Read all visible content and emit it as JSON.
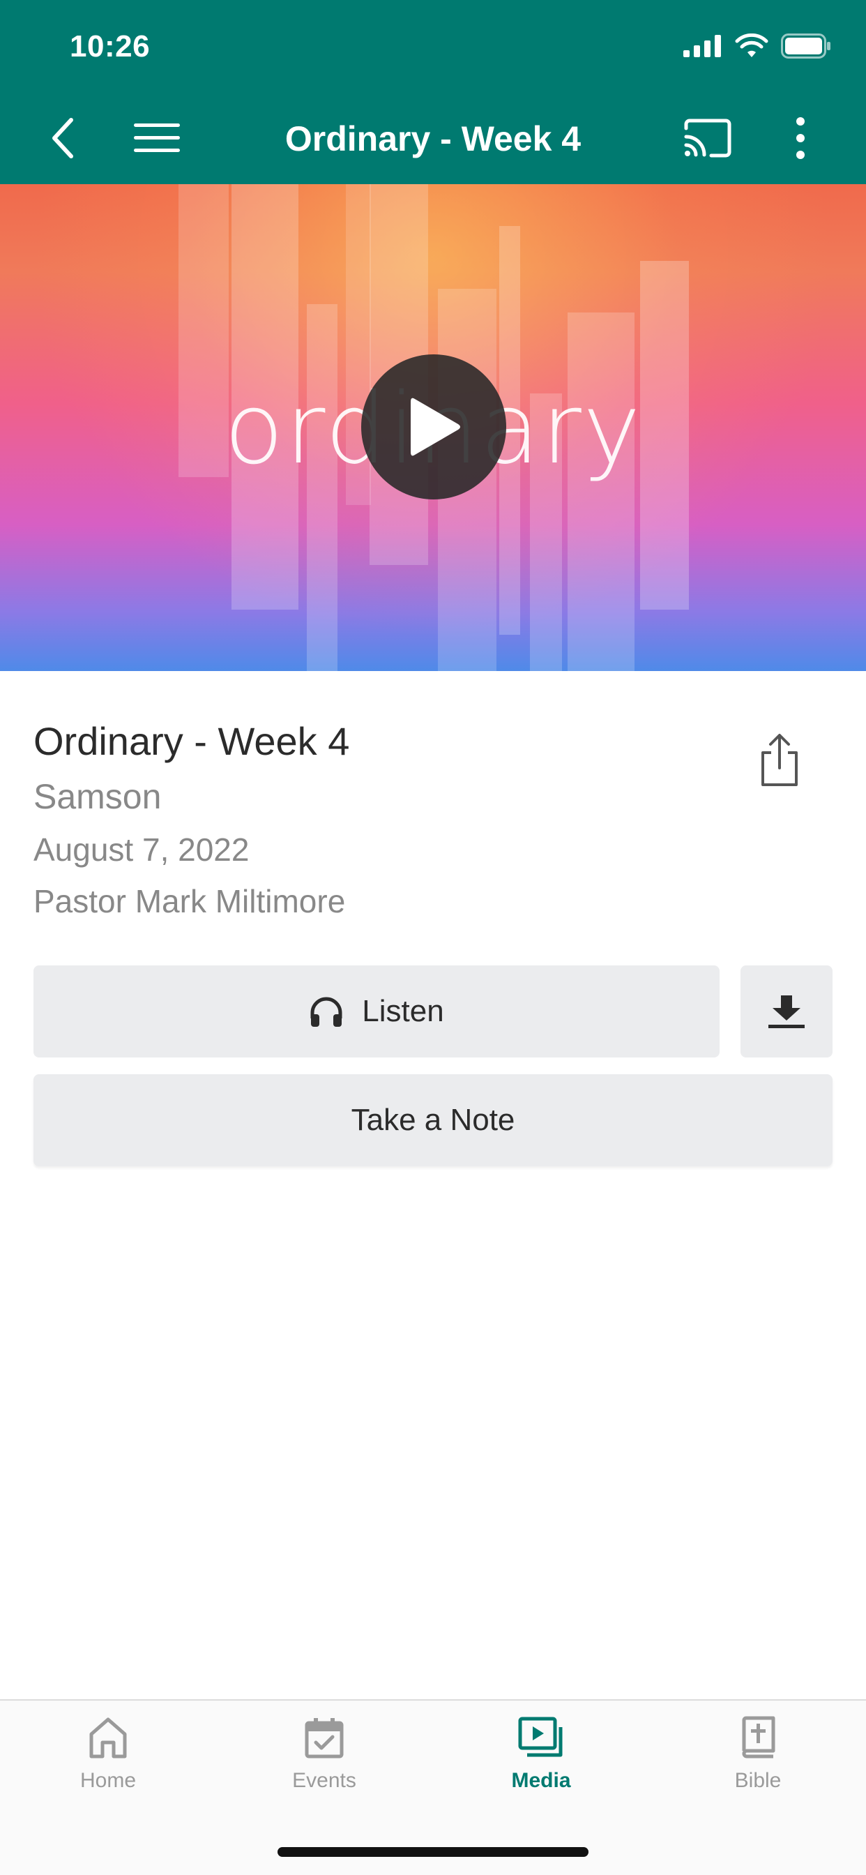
{
  "status": {
    "time": "10:26"
  },
  "header": {
    "title": "Ordinary - Week 4"
  },
  "hero": {
    "word": "ordinary"
  },
  "details": {
    "title": "Ordinary - Week 4",
    "subtitle": "Samson",
    "date": "August 7, 2022",
    "speaker": "Pastor Mark Miltimore"
  },
  "actions": {
    "listen_label": "Listen",
    "note_label": "Take a Note"
  },
  "tabs": [
    {
      "label": "Home",
      "icon": "home-icon"
    },
    {
      "label": "Events",
      "icon": "calendar-icon"
    },
    {
      "label": "Media",
      "icon": "media-icon"
    },
    {
      "label": "Bible",
      "icon": "bible-icon"
    }
  ],
  "active_tab": "Media",
  "colors": {
    "brand": "#007a70",
    "button_bg": "#ebecee",
    "inactive": "#9a9a9a"
  }
}
